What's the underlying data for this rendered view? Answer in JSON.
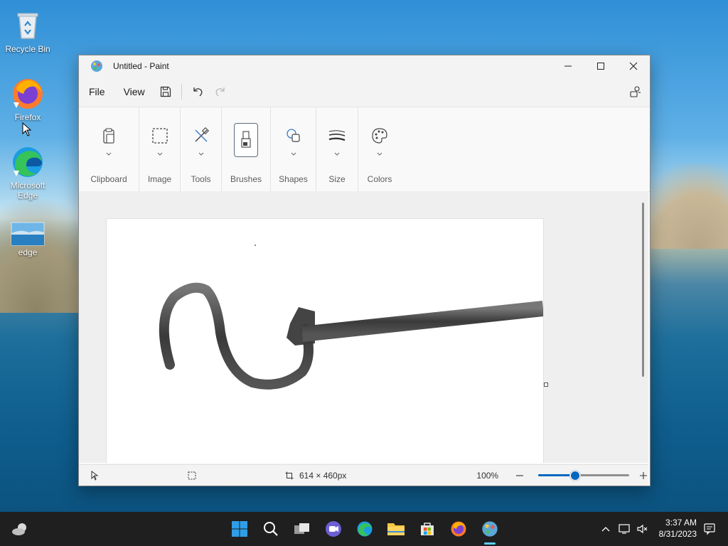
{
  "desktop": {
    "icons": [
      {
        "label": "Recycle Bin"
      },
      {
        "label": "Firefox"
      },
      {
        "label": "Microsoft Edge"
      },
      {
        "label": "edge"
      }
    ]
  },
  "window": {
    "title": "Untitled - Paint",
    "menu": {
      "file": "File",
      "view": "View"
    },
    "ribbon": {
      "groups": [
        {
          "label": "Clipboard",
          "icon": "clipboard-icon"
        },
        {
          "label": "Image",
          "icon": "selection-icon"
        },
        {
          "label": "Tools",
          "icon": "tools-icon"
        },
        {
          "label": "Brushes",
          "icon": "brush-icon"
        },
        {
          "label": "Shapes",
          "icon": "shapes-icon"
        },
        {
          "label": "Size",
          "icon": "stroke-size-icon"
        },
        {
          "label": "Colors",
          "icon": "palette-icon"
        }
      ]
    },
    "status": {
      "canvas_size": "614 × 460px",
      "zoom": "100%",
      "zoom_fraction": 0.4
    }
  },
  "taskbar": {
    "time": "3:37 AM",
    "date": "8/31/2023"
  },
  "colors": {
    "accent": "#0067c0",
    "taskbar": "#1f1f1f"
  }
}
